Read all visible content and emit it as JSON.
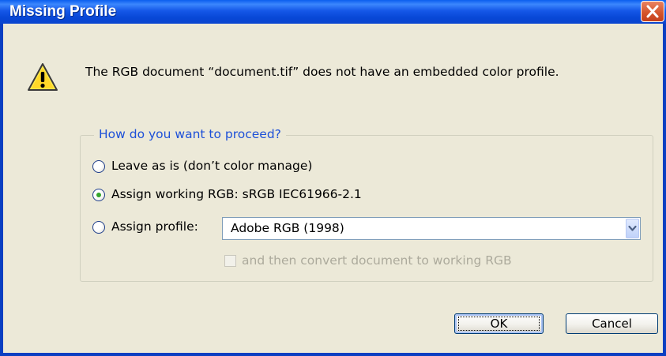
{
  "window": {
    "title": "Missing Profile",
    "close_icon": "close-icon",
    "accent": "#0a58e6",
    "close_color": "#d5562d"
  },
  "message": {
    "icon": "warning-icon",
    "text": "The RGB document “document.tif” does not have an embedded color profile."
  },
  "group": {
    "legend": "How do you want to proceed?",
    "options": [
      {
        "label": "Leave as is (don’t color manage)",
        "selected": false
      },
      {
        "label": "Assign working RGB:  sRGB IEC61966-2.1",
        "selected": true
      },
      {
        "label": "Assign profile:",
        "selected": false
      }
    ],
    "profile_select": {
      "value": "Adobe RGB (1998)",
      "arrow_icon": "chevron-down-icon"
    },
    "convert_checkbox": {
      "label": "and then convert document to working RGB",
      "checked": false,
      "disabled": true
    }
  },
  "buttons": {
    "ok": "OK",
    "cancel": "Cancel"
  }
}
